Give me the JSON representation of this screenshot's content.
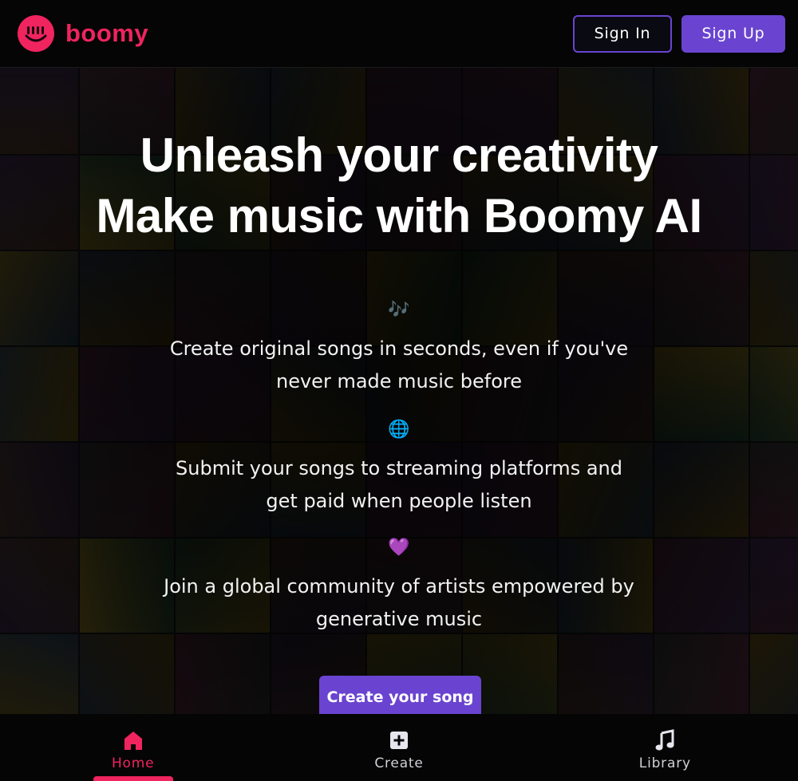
{
  "header": {
    "brand_name": "boomy",
    "sign_in_label": "Sign In",
    "sign_up_label": "Sign Up"
  },
  "hero": {
    "headline_line1": "Unleash your creativity",
    "headline_line2": "Make music with Boomy AI",
    "features": [
      {
        "emoji": "🎶",
        "icon_name": "musical-notes-icon",
        "text": "Create original songs in seconds, even if you've never made music before"
      },
      {
        "emoji": "🌐",
        "icon_name": "globe-icon",
        "text": "Submit your songs to streaming platforms and get paid when people listen"
      },
      {
        "emoji": "💜",
        "icon_name": "purple-heart-icon",
        "text": "Join a global community of artists empowered by generative music"
      }
    ],
    "cta_label": "Create your song"
  },
  "bottom_nav": {
    "items": [
      {
        "label": "Home",
        "icon": "home-icon",
        "active": true
      },
      {
        "label": "Create",
        "icon": "plus-square-icon",
        "active": false
      },
      {
        "label": "Library",
        "icon": "music-note-icon",
        "active": false
      }
    ]
  },
  "colors": {
    "brand": "#f0245f",
    "accent": "#6a44d0",
    "background": "#000000"
  }
}
